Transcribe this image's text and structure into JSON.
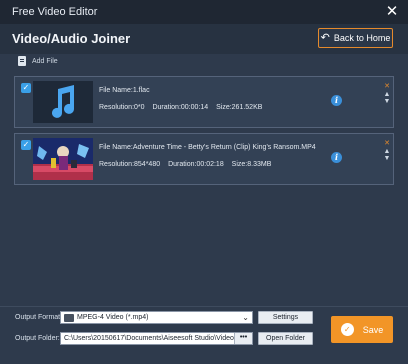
{
  "window": {
    "title": "Free Video Editor",
    "close_glyph": "✕"
  },
  "header": {
    "title": "Video/Audio Joiner",
    "back_label": "Back to Home",
    "back_glyph": "↶"
  },
  "toolbar": {
    "add_file_label": "Add File"
  },
  "files": [
    {
      "name": "File Name:1.flac",
      "resolution": "Resolution:0*0",
      "duration": "Duration:00:00:14",
      "size": "Size:261.52KB",
      "thumb_icon": "music-note-icon"
    },
    {
      "name": "File Name:Adventure Time - Betty's Return (Clip) King's Ransom.MP4",
      "resolution": "Resolution:854*480",
      "duration": "Duration:00:02:18",
      "size": "Size:8.33MB",
      "thumb_icon": "video-thumbnail"
    }
  ],
  "item_controls": {
    "remove_glyph": "✕",
    "up_glyph": "▲",
    "down_glyph": "▼",
    "info_glyph": "i",
    "check_glyph": "✓"
  },
  "bottom": {
    "format_label": "Output Format:",
    "format_value": "MPEG-4 Video (*.mp4)",
    "settings_label": "Settings",
    "folder_label": "Output Folder:",
    "folder_value": "C:\\Users\\20150617\\Documents\\Aiseesoft Studio\\Video",
    "dots_label": "•••",
    "open_folder_label": "Open Folder",
    "save_label": "Save",
    "select_chevron": "⌄"
  },
  "colors": {
    "accent_orange": "#f29527",
    "checkbox_blue": "#3aa0e8",
    "info_blue": "#3a8fd9",
    "background": "#2e3a4c"
  }
}
